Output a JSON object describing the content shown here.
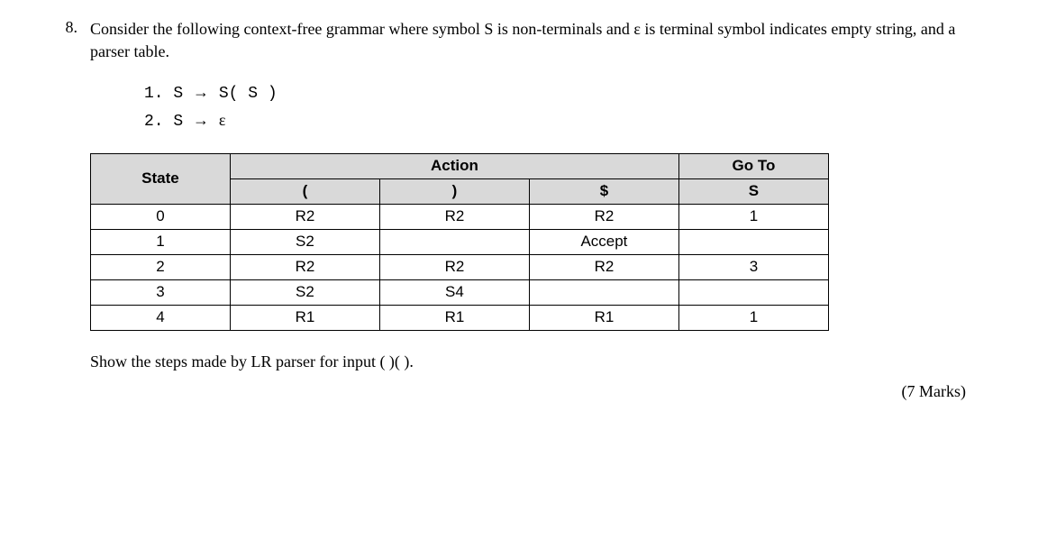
{
  "q_number": "8.",
  "prompt_text": "Consider the following context-free grammar where symbol S is non-terminals and ε is terminal symbol indicates empty string, and a parser table.",
  "grammar": {
    "line1_num": "1.",
    "line1_lhs": "S",
    "line1_arrow": "→",
    "line1_rhs": "S( S )",
    "line2_num": "2.",
    "line2_lhs": "S",
    "line2_arrow": "→",
    "line2_rhs": "ε"
  },
  "table": {
    "hdr_state": "State",
    "hdr_action": "Action",
    "hdr_goto": "Go To",
    "sub_lparen": "(",
    "sub_rparen": ")",
    "sub_dollar": "$",
    "sub_s": "S",
    "rows": [
      {
        "state": "0",
        "lparen": "R2",
        "rparen": "R2",
        "dollar": "R2",
        "s": "1"
      },
      {
        "state": "1",
        "lparen": "S2",
        "rparen": "",
        "dollar": "Accept",
        "s": ""
      },
      {
        "state": "2",
        "lparen": "R2",
        "rparen": "R2",
        "dollar": "R2",
        "s": "3"
      },
      {
        "state": "3",
        "lparen": "S2",
        "rparen": "S4",
        "dollar": "",
        "s": ""
      },
      {
        "state": "4",
        "lparen": "R1",
        "rparen": "R1",
        "dollar": "R1",
        "s": "1"
      }
    ]
  },
  "second_prompt": "Show the steps made by LR parser for input ( )( ).",
  "marks": "(7 Marks)"
}
